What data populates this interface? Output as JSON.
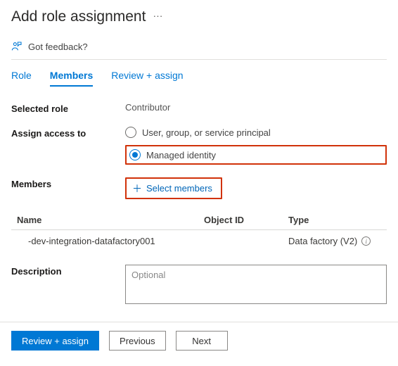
{
  "header": {
    "title": "Add role assignment",
    "feedback_label": "Got feedback?"
  },
  "tabs": {
    "role": "Role",
    "members": "Members",
    "review": "Review + assign"
  },
  "fields": {
    "selected_role_label": "Selected role",
    "selected_role_value": "Contributor",
    "assign_access_label": "Assign access to",
    "radio_user": "User, group, or service principal",
    "radio_managed": "Managed identity",
    "members_label": "Members",
    "select_members_label": "Select members",
    "description_label": "Description",
    "description_placeholder": "Optional"
  },
  "members_table": {
    "columns": {
      "name": "Name",
      "object_id": "Object ID",
      "type": "Type"
    },
    "rows": [
      {
        "name": "-dev-integration-datafactory001",
        "object_id": "",
        "type": "Data factory (V2)"
      }
    ]
  },
  "footer": {
    "review": "Review + assign",
    "previous": "Previous",
    "next": "Next"
  }
}
